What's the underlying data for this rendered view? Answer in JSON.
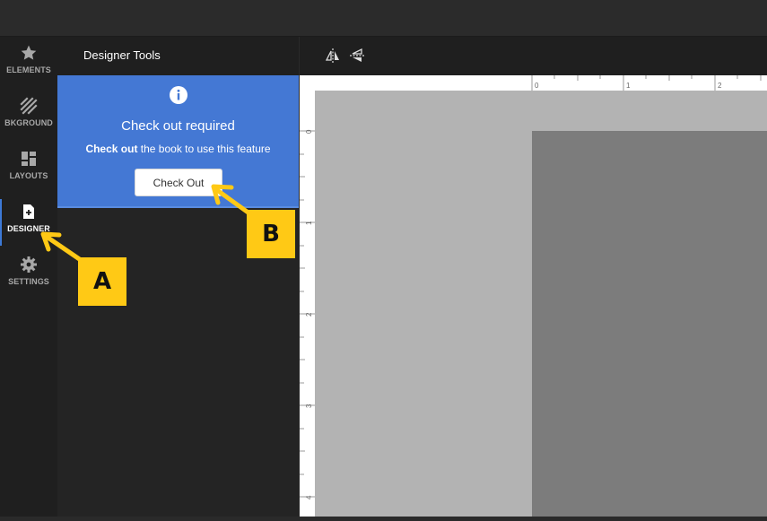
{
  "rail": {
    "items": [
      {
        "label": "ELEMENTS",
        "icon": "star-icon"
      },
      {
        "label": "BKGROUND",
        "icon": "background-hatch-icon"
      },
      {
        "label": "LAYOUTS",
        "icon": "layouts-grid-icon"
      },
      {
        "label": "DESIGNER",
        "icon": "add-page-icon",
        "active": true
      },
      {
        "label": "SETTINGS",
        "icon": "gear-icon"
      }
    ]
  },
  "panel": {
    "title": "Designer Tools",
    "notice": {
      "title": "Check out required",
      "desc_bold": "Check out",
      "desc_rest": " the book to use this feature",
      "button": "Check Out"
    }
  },
  "toolbar": {
    "tools": [
      "flip-horizontal-icon",
      "flip-vertical-icon"
    ]
  },
  "ruler": {
    "top_labels": [
      "0",
      "1",
      "2"
    ],
    "left_labels": [
      "0",
      "1",
      "2",
      "3",
      "4"
    ]
  },
  "annotations": {
    "a": "A",
    "b": "B"
  },
  "colors": {
    "accent": "#4478d4",
    "badge": "#ffc915"
  }
}
